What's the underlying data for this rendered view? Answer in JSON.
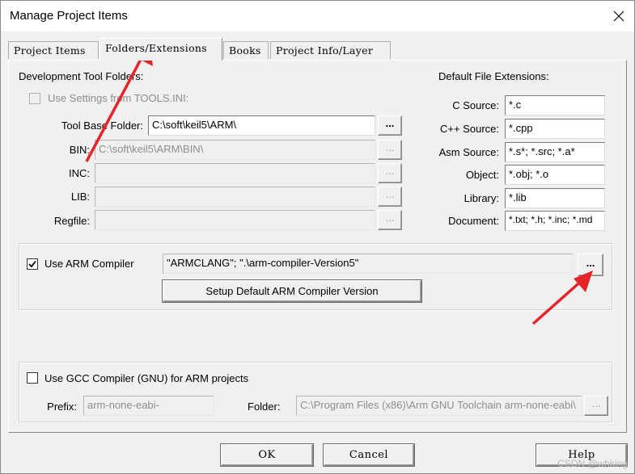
{
  "window": {
    "title": "Manage Project Items"
  },
  "tabs": [
    {
      "label": "Project Items"
    },
    {
      "label": "Folders/Extensions"
    },
    {
      "label": "Books"
    },
    {
      "label": "Project Info/Layer"
    }
  ],
  "dev_tools": {
    "heading": "Development Tool Folders:",
    "use_settings_label": "Use Settings from TOOLS.INI:",
    "tool_base_label": "Tool Base Folder:",
    "tool_base_value": "C:\\soft\\keil5\\ARM\\",
    "bin_label": "BIN:",
    "bin_value": "C:\\soft\\keil5\\ARM\\BIN\\",
    "inc_label": "INC:",
    "inc_value": "",
    "lib_label": "LIB:",
    "lib_value": "",
    "regfile_label": "Regfile:",
    "regfile_value": "",
    "browse_label": "..."
  },
  "extensions": {
    "heading": "Default File Extensions:",
    "rows": [
      {
        "label": "C Source:",
        "value": "*.c"
      },
      {
        "label": "C++ Source:",
        "value": "*.cpp"
      },
      {
        "label": "Asm Source:",
        "value": "*.s*; *.src; *.a*"
      },
      {
        "label": "Object:",
        "value": "*.obj; *.o"
      },
      {
        "label": "Library:",
        "value": "*.lib"
      },
      {
        "label": "Document:",
        "value": "*.txt; *.h; *.inc; *.md"
      }
    ]
  },
  "arm": {
    "checkbox_label": "Use ARM Compiler",
    "checked": true,
    "compiler_value": "\"ARMCLANG\"; \".\\arm-compiler-Version5\"",
    "browse_label": "...",
    "setup_button": "Setup Default ARM Compiler Version"
  },
  "gcc": {
    "checkbox_label": "Use GCC Compiler (GNU) for ARM projects",
    "checked": false,
    "prefix_label": "Prefix:",
    "prefix_value": "arm-none-eabi-",
    "folder_label": "Folder:",
    "folder_value": "C:\\Program Files (x86)\\Arm GNU Toolchain arm-none-eabi\\",
    "browse_label": "..."
  },
  "buttons": {
    "ok": "OK",
    "cancel": "Cancel",
    "help": "Help"
  },
  "watermark": "CSDN @whking",
  "colors": {
    "annotation_arrow": "#e8242b",
    "dialog_bg": "#f0f0f0"
  }
}
